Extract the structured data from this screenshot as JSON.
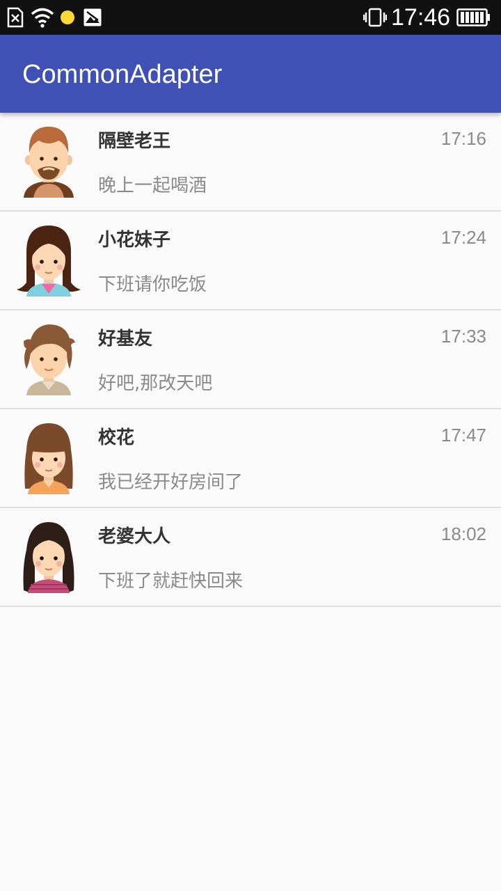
{
  "status_bar": {
    "time": "17:46",
    "icons": [
      "sim-card-missing-icon",
      "wifi-icon",
      "notification-dot-icon",
      "image-icon",
      "vibrate-icon",
      "battery-icon"
    ]
  },
  "app_bar": {
    "title": "CommonAdapter"
  },
  "conversations": [
    {
      "name": "隔壁老王",
      "message": "晚上一起喝酒",
      "time": "17:16",
      "avatar": "bearded-man-avatar"
    },
    {
      "name": "小花妹子",
      "message": "下班请你吃饭",
      "time": "17:24",
      "avatar": "dark-haired-girl-avatar"
    },
    {
      "name": "好基友",
      "message": "好吧,那改天吧",
      "time": "17:33",
      "avatar": "shaggy-haired-boy-avatar"
    },
    {
      "name": "校花",
      "message": "我已经开好房间了",
      "time": "17:47",
      "avatar": "bangs-girl-avatar"
    },
    {
      "name": "老婆大人",
      "message": "下班了就赶快回来",
      "time": "18:02",
      "avatar": "black-haired-woman-avatar"
    }
  ],
  "colors": {
    "primary": "#3f51b5",
    "status_bar": "#111111",
    "background": "#fafafa",
    "divider": "#dcdcdc"
  }
}
